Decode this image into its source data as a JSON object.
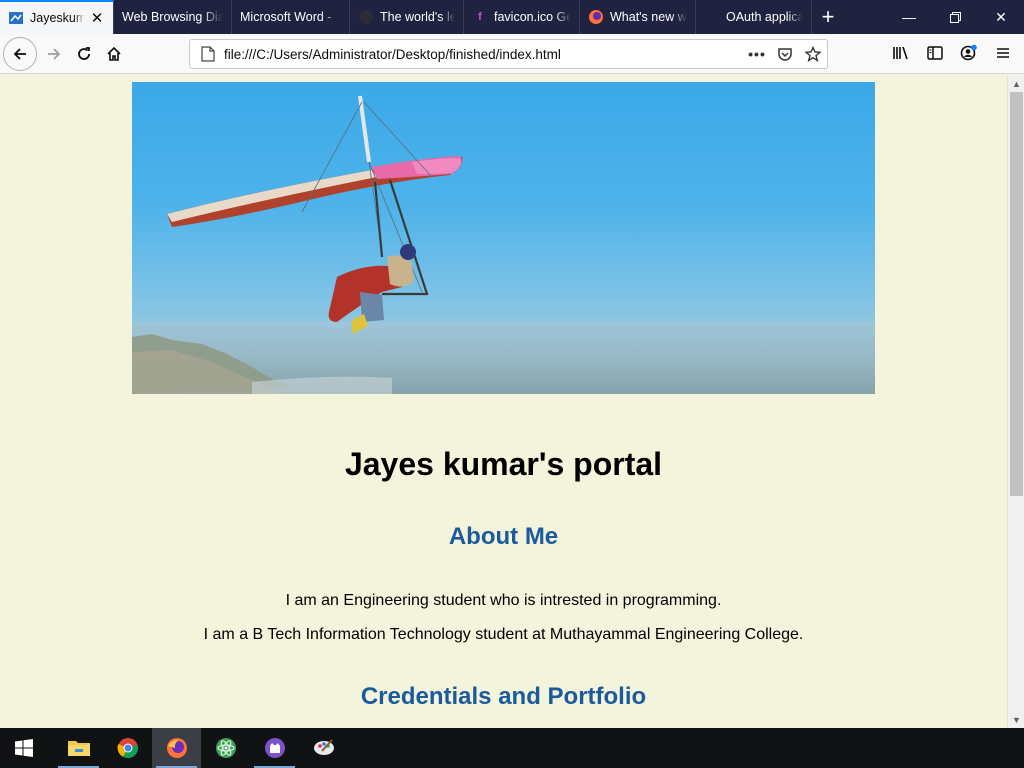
{
  "browser": {
    "tabs": [
      {
        "label": "Jayeskumar's portal",
        "active": true,
        "icon": "document-blue-icon"
      },
      {
        "label": "Web Browsing Diagram",
        "active": false,
        "icon": ""
      },
      {
        "label": "Microsoft Word - ",
        "active": false,
        "icon": ""
      },
      {
        "label": "The world's leading",
        "active": false,
        "icon": "github-icon"
      },
      {
        "label": "favicon.ico Generator",
        "active": false,
        "icon": "favicon-generator-icon"
      },
      {
        "label": "What's new with",
        "active": false,
        "icon": "firefox-icon"
      },
      {
        "label": "OAuth applications",
        "active": false,
        "icon": ""
      }
    ],
    "url": "file:///C:/Users/Administrator/Desktop/finished/index.html"
  },
  "page": {
    "title": "Jayes kumar's portal",
    "about_heading": "About Me",
    "about_line1": "I am an Engineering student who is intrested in programming.",
    "about_line2": "I am a B Tech Information Technology student at Muthayammal Engineering College.",
    "credentials_heading": "Credentials and Portfolio"
  },
  "colors": {
    "page_background": "#f4f3dc",
    "heading_blue": "#1a5b9c",
    "tabstrip": "#202340",
    "accent": "#0a84ff"
  },
  "taskbar": {
    "items": [
      "windows-start-icon",
      "file-explorer-icon",
      "chrome-icon",
      "firefox-icon",
      "atom-icon",
      "github-desktop-icon",
      "paint-icon"
    ]
  }
}
